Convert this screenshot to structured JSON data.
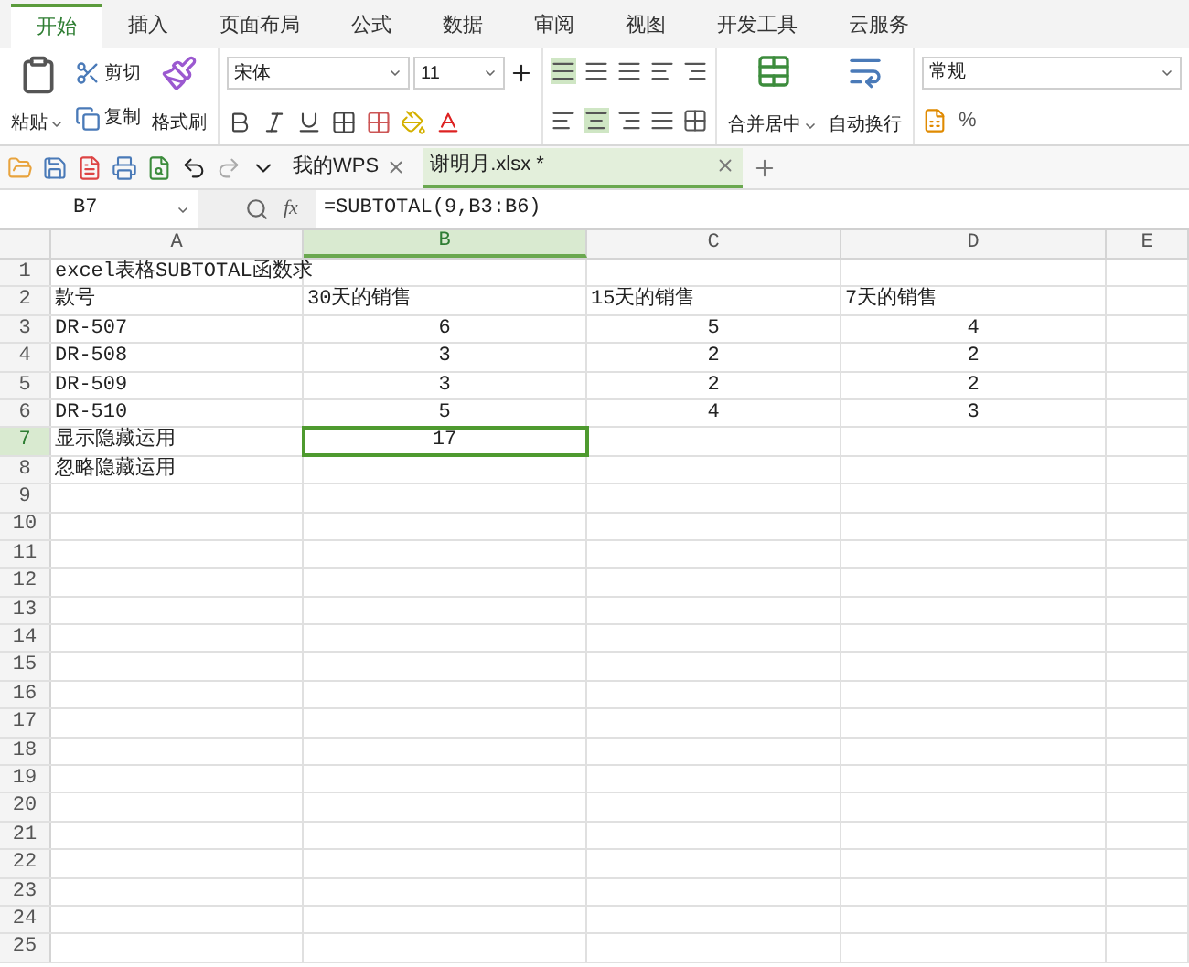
{
  "menu_tabs": [
    {
      "label": "开始",
      "selected": true
    },
    {
      "label": "插入",
      "selected": false
    },
    {
      "label": "页面布局",
      "selected": false
    },
    {
      "label": "公式",
      "selected": false
    },
    {
      "label": "数据",
      "selected": false
    },
    {
      "label": "审阅",
      "selected": false
    },
    {
      "label": "视图",
      "selected": false
    },
    {
      "label": "开发工具",
      "selected": false
    },
    {
      "label": "云服务",
      "selected": false
    }
  ],
  "ribbon": {
    "paste": "粘贴",
    "cut": "剪切",
    "copy": "复制",
    "format_painter": "格式刷",
    "font_name": "宋体",
    "font_size": "11",
    "merge": "合并居中",
    "wrap": "自动换行",
    "number_format": "常规",
    "percent": "%"
  },
  "doc_tabs": [
    {
      "label": "我的WPS",
      "selected": false
    },
    {
      "label": "谢明月.xlsx *",
      "selected": true
    }
  ],
  "name_box": "B7",
  "fx": "fx",
  "formula": "=SUBTOTAL(9,B3:B6)",
  "columns": [
    {
      "label": "A",
      "selected": false
    },
    {
      "label": "B",
      "selected": true
    },
    {
      "label": "C",
      "selected": false
    },
    {
      "label": "D",
      "selected": false
    },
    {
      "label": "E",
      "selected": false
    }
  ],
  "rows": [
    {
      "number": "1",
      "selected": false,
      "kind": "text",
      "cells": [
        "excel表格SUBTOTAL函数求",
        null,
        null,
        null,
        null
      ]
    },
    {
      "number": "2",
      "selected": false,
      "kind": "text",
      "cells": [
        "款号",
        "30天的销售",
        "15天的销售",
        "7天的销售",
        null
      ]
    },
    {
      "number": "3",
      "selected": false,
      "kind": "numbers",
      "cells": [
        "DR-507",
        "6",
        "5",
        "4",
        null
      ]
    },
    {
      "number": "4",
      "selected": false,
      "kind": "numbers",
      "cells": [
        "DR-508",
        "3",
        "2",
        "2",
        null
      ]
    },
    {
      "number": "5",
      "selected": false,
      "kind": "numbers",
      "cells": [
        "DR-509",
        "3",
        "2",
        "2",
        null
      ]
    },
    {
      "number": "6",
      "selected": false,
      "kind": "numbers",
      "cells": [
        "DR-510",
        "5",
        "4",
        "3",
        null
      ]
    },
    {
      "number": "7",
      "selected": true,
      "kind": "numbers",
      "cells": [
        "显示隐藏运用",
        "17",
        null,
        null,
        null
      ]
    },
    {
      "number": "8",
      "selected": false,
      "kind": "text",
      "cells": [
        "忽略隐藏运用",
        null,
        null,
        null,
        null
      ]
    },
    {
      "number": "9",
      "selected": false,
      "kind": "text",
      "cells": [
        null,
        null,
        null,
        null,
        null
      ]
    },
    {
      "number": "10",
      "selected": false,
      "kind": "text",
      "cells": [
        null,
        null,
        null,
        null,
        null
      ]
    },
    {
      "number": "11",
      "selected": false,
      "kind": "text",
      "cells": [
        null,
        null,
        null,
        null,
        null
      ]
    },
    {
      "number": "12",
      "selected": false,
      "kind": "text",
      "cells": [
        null,
        null,
        null,
        null,
        null
      ]
    },
    {
      "number": "13",
      "selected": false,
      "kind": "text",
      "cells": [
        null,
        null,
        null,
        null,
        null
      ]
    },
    {
      "number": "14",
      "selected": false,
      "kind": "text",
      "cells": [
        null,
        null,
        null,
        null,
        null
      ]
    },
    {
      "number": "15",
      "selected": false,
      "kind": "text",
      "cells": [
        null,
        null,
        null,
        null,
        null
      ]
    },
    {
      "number": "16",
      "selected": false,
      "kind": "text",
      "cells": [
        null,
        null,
        null,
        null,
        null
      ]
    },
    {
      "number": "17",
      "selected": false,
      "kind": "text",
      "cells": [
        null,
        null,
        null,
        null,
        null
      ]
    },
    {
      "number": "18",
      "selected": false,
      "kind": "text",
      "cells": [
        null,
        null,
        null,
        null,
        null
      ]
    },
    {
      "number": "19",
      "selected": false,
      "kind": "text",
      "cells": [
        null,
        null,
        null,
        null,
        null
      ]
    },
    {
      "number": "20",
      "selected": false,
      "kind": "text",
      "cells": [
        null,
        null,
        null,
        null,
        null
      ]
    },
    {
      "number": "21",
      "selected": false,
      "kind": "text",
      "cells": [
        null,
        null,
        null,
        null,
        null
      ]
    },
    {
      "number": "22",
      "selected": false,
      "kind": "text",
      "cells": [
        null,
        null,
        null,
        null,
        null
      ]
    },
    {
      "number": "23",
      "selected": false,
      "kind": "text",
      "cells": [
        null,
        null,
        null,
        null,
        null
      ]
    },
    {
      "number": "24",
      "selected": false,
      "kind": "text",
      "cells": [
        null,
        null,
        null,
        null,
        null
      ]
    },
    {
      "number": "25",
      "selected": false,
      "kind": "text",
      "cells": [
        null,
        null,
        null,
        null,
        null
      ]
    }
  ]
}
